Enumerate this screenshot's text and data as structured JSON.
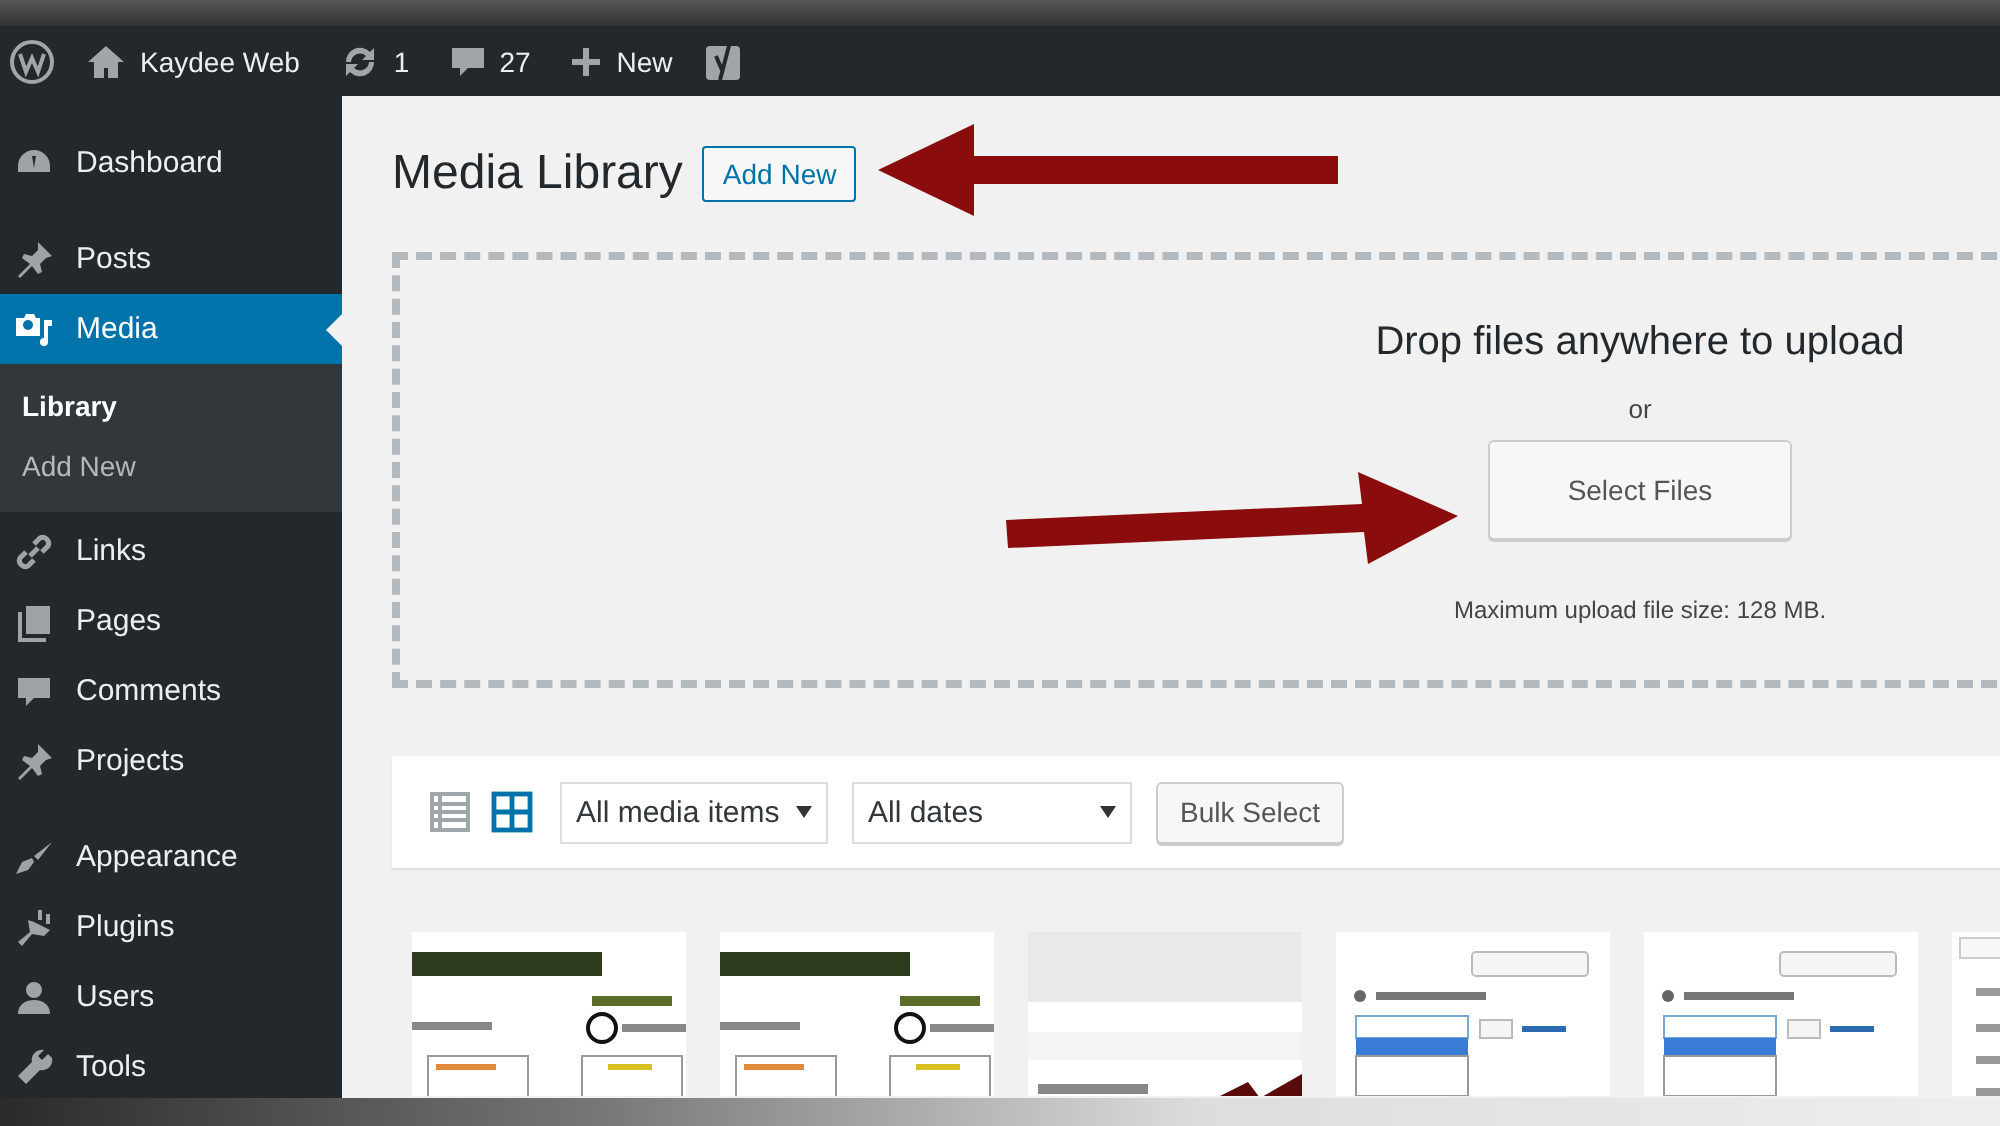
{
  "admin_bar": [
    {
      "kind": "wordpress"
    },
    {
      "kind": "home",
      "label": "Kaydee Web"
    },
    {
      "kind": "updates",
      "label": "1"
    },
    {
      "kind": "comments",
      "label": "27"
    },
    {
      "kind": "new",
      "label": "New"
    },
    {
      "kind": "yoast"
    }
  ],
  "sidebar": {
    "items": [
      {
        "label": "Dashboard",
        "selected": false
      },
      {
        "label": "Posts",
        "selected": false
      },
      {
        "label": "Media",
        "selected": true,
        "children": [
          {
            "label": "Library",
            "selected": true
          },
          {
            "label": "Add New",
            "selected": false
          }
        ]
      },
      {
        "label": "Links",
        "selected": false
      },
      {
        "label": "Pages",
        "selected": false
      },
      {
        "label": "Comments",
        "selected": false
      },
      {
        "label": "Projects",
        "selected": false
      },
      {
        "label": "Appearance",
        "selected": false
      },
      {
        "label": "Plugins",
        "selected": false
      },
      {
        "label": "Users",
        "selected": false
      },
      {
        "label": "Tools",
        "selected": false
      }
    ]
  },
  "page": {
    "title": "Media Library",
    "add_new_button": "Add New"
  },
  "upload": {
    "heading": "Drop files anywhere to upload",
    "or": "or",
    "button": "Select Files",
    "max_size": "Maximum upload file size: 128 MB."
  },
  "toolbar": {
    "view_modes": [
      {
        "kind": "list",
        "selected": false
      },
      {
        "kind": "grid",
        "selected": true
      }
    ],
    "filters": [
      {
        "value": "All media items"
      },
      {
        "value": "All dates"
      }
    ],
    "bulk_select": "Bulk Select"
  }
}
